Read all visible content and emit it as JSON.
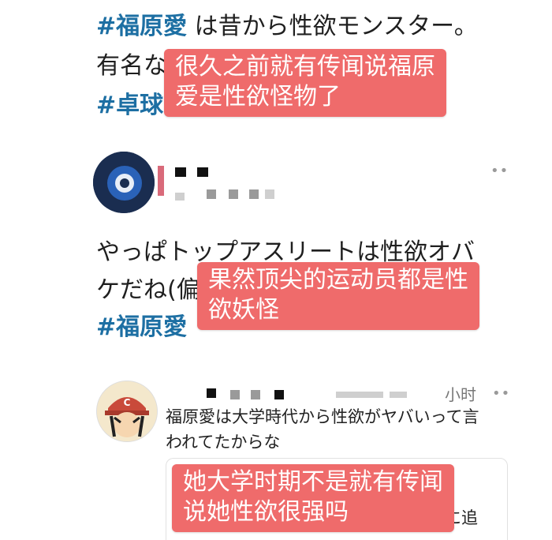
{
  "tweet1": {
    "hashtag": "#福原愛",
    "text_line1": " は昔から性欲モンスター。",
    "text_line2_prefix": "有名な",
    "hashtag2": "#卓球",
    "overlay_line1": "很久之前就有传闻说福原",
    "overlay_line2": "爱是性欲怪物了"
  },
  "tweet2": {
    "text_line1": "やっぱトップアスリートは性欲オバ",
    "text_line2_prefix": "ケだね(偏",
    "hashtag": "#福原愛",
    "overlay_line1": "果然顶尖的运动员都是性",
    "overlay_line2": "欲妖怪",
    "more_icon": "more-dots-icon"
  },
  "tweet3": {
    "time": "小时",
    "text_line1": "福原愛は大学時代から性欲がヤバいって言",
    "text_line2": "われてたからな",
    "quoted_text": "離婚決意に追",
    "overlay_line1": "她大学时期不是就有传闻",
    "overlay_line2": "说她性欲很强吗",
    "more_icon": "more-dots-icon"
  }
}
